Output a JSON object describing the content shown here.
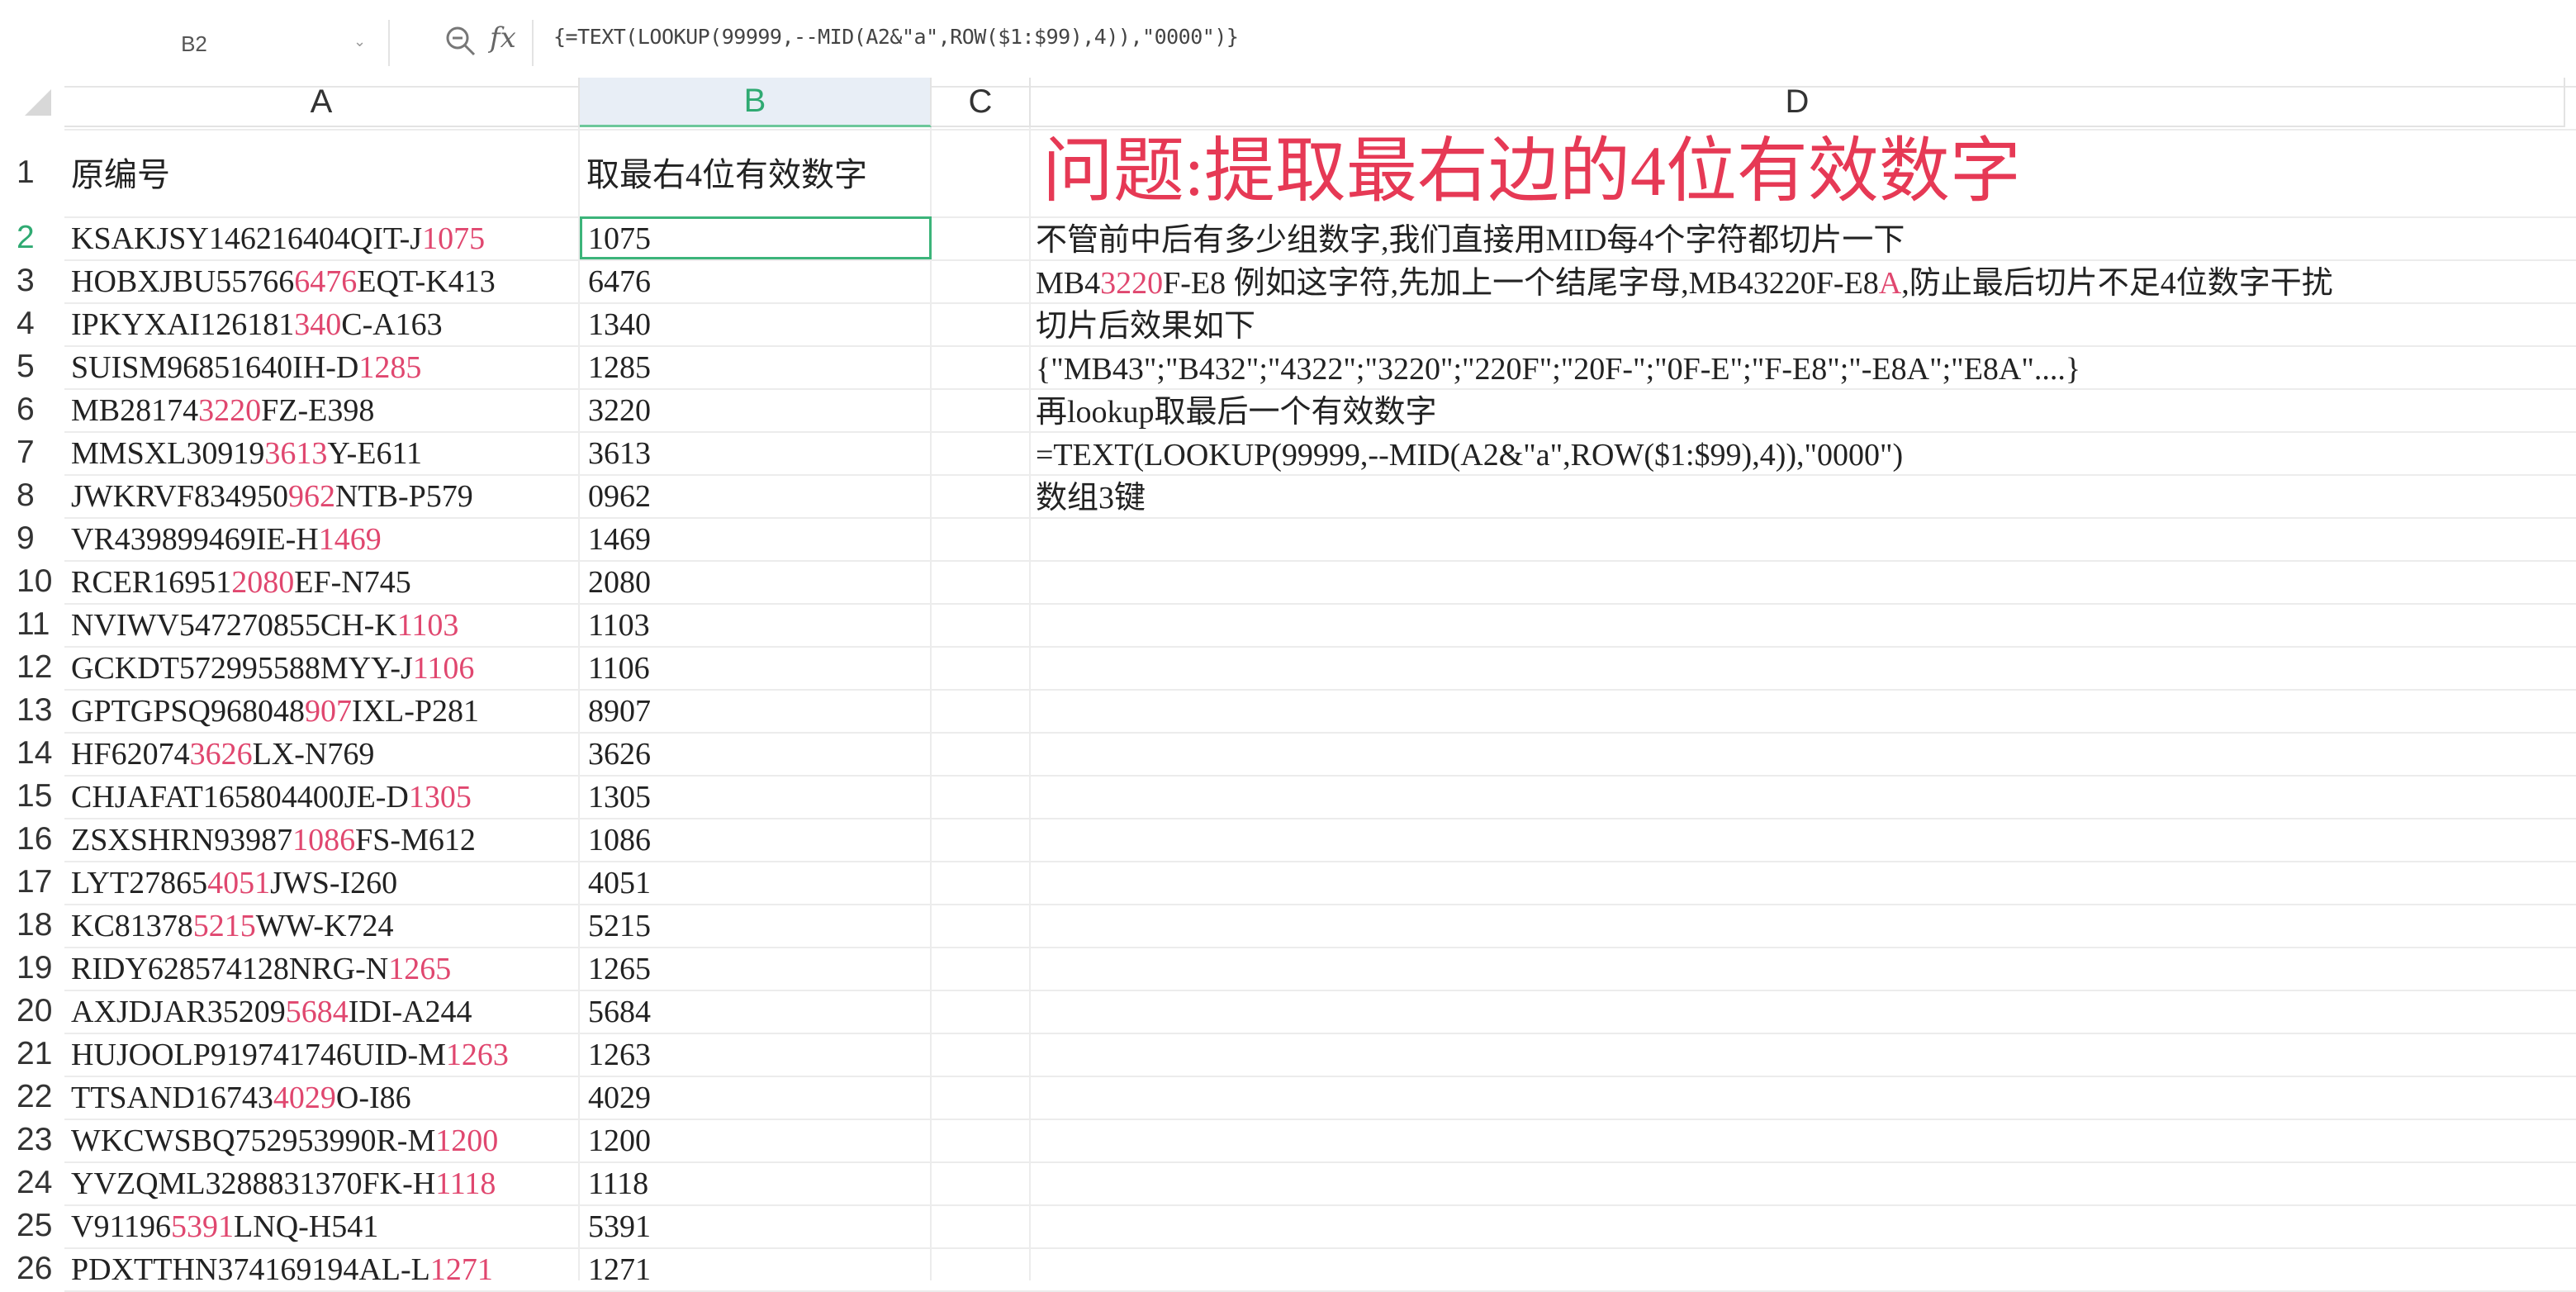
{
  "formula_bar": {
    "name_box": "B2",
    "fx_label": "fx",
    "formula": "{=TEXT(LOOKUP(99999,--MID(A2&\"a\",ROW($1:$99),4)),\"0000\")}"
  },
  "columns": [
    "A",
    "B",
    "C",
    "D"
  ],
  "selected_cell": "B2",
  "header_row": {
    "row_number": "1",
    "a": "原编号",
    "b": "取最右4位有效数字"
  },
  "rows": [
    {
      "n": "2",
      "a_pre": "KSAKJSY146216404QIT-J",
      "a_hl": "1075",
      "a_post": "",
      "b": "1075"
    },
    {
      "n": "3",
      "a_pre": "HOBXJBU55766",
      "a_hl": "6476",
      "a_post": "EQT-K413",
      "b": "6476"
    },
    {
      "n": "4",
      "a_pre": "IPKYXAI126181",
      "a_hl": "340",
      "a_post": "C-A163",
      "b": "1340"
    },
    {
      "n": "5",
      "a_pre": "SUISM96851640IH-D",
      "a_hl": "1285",
      "a_post": "",
      "b": "1285"
    },
    {
      "n": "6",
      "a_pre": "MB28174",
      "a_hl": "3220",
      "a_post": "FZ-E398",
      "b": "3220"
    },
    {
      "n": "7",
      "a_pre": "MMSXL30919",
      "a_hl": "3613",
      "a_post": "Y-E611",
      "b": "3613"
    },
    {
      "n": "8",
      "a_pre": "JWKRVF834950",
      "a_hl": "962",
      "a_post": "NTB-P579",
      "b": "0962"
    },
    {
      "n": "9",
      "a_pre": "VR439899469IE-H",
      "a_hl": "1469",
      "a_post": "",
      "b": "1469"
    },
    {
      "n": "10",
      "a_pre": "RCER16951",
      "a_hl": "2080",
      "a_post": "EF-N745",
      "b": "2080"
    },
    {
      "n": "11",
      "a_pre": "NVIWV547270855CH-K",
      "a_hl": "1103",
      "a_post": "",
      "b": "1103"
    },
    {
      "n": "12",
      "a_pre": "GCKDT572995588MYY-J",
      "a_hl": "1106",
      "a_post": "",
      "b": "1106"
    },
    {
      "n": "13",
      "a_pre": "GPTGPSQ968048",
      "a_hl": "907",
      "a_post": "IXL-P281",
      "b": "8907"
    },
    {
      "n": "14",
      "a_pre": "HF62074",
      "a_hl": "3626",
      "a_post": "LX-N769",
      "b": "3626"
    },
    {
      "n": "15",
      "a_pre": "CHJAFAT165804400JE-D",
      "a_hl": "1305",
      "a_post": "",
      "b": "1305"
    },
    {
      "n": "16",
      "a_pre": "ZSXSHRN93987",
      "a_hl": "1086",
      "a_post": "FS-M612",
      "b": "1086"
    },
    {
      "n": "17",
      "a_pre": "LYT27865",
      "a_hl": "4051",
      "a_post": "JWS-I260",
      "b": "4051"
    },
    {
      "n": "18",
      "a_pre": "KC81378",
      "a_hl": "5215",
      "a_post": "WW-K724",
      "b": "5215"
    },
    {
      "n": "19",
      "a_pre": "RIDY628574128NRG-N",
      "a_hl": "1265",
      "a_post": "",
      "b": "1265"
    },
    {
      "n": "20",
      "a_pre": "AXJDJAR35209",
      "a_hl": "5684",
      "a_post": "IDI-A244",
      "b": "5684"
    },
    {
      "n": "21",
      "a_pre": "HUJOOLP919741746UID-M",
      "a_hl": "1263",
      "a_post": "",
      "b": "1263"
    },
    {
      "n": "22",
      "a_pre": "TTSAND16743",
      "a_hl": "4029",
      "a_post": "O-I86",
      "b": "4029"
    },
    {
      "n": "23",
      "a_pre": "WKCWSBQ752953990R-M",
      "a_hl": "1200",
      "a_post": "",
      "b": "1200"
    },
    {
      "n": "24",
      "a_pre": "YVZQML3288831370FK-H",
      "a_hl": "1118",
      "a_post": "",
      "b": "1118"
    },
    {
      "n": "25",
      "a_pre": "V91196",
      "a_hl": "5391",
      "a_post": "LNQ-H541",
      "b": "5391"
    },
    {
      "n": "26",
      "a_pre": "PDXTTHN374169194AL-L",
      "a_hl": "1271",
      "a_post": "",
      "b": "1271"
    }
  ],
  "notes": {
    "title": "问题:提取最右边的4位有效数字",
    "line1": "不管前中后有多少组数字,我们直接用MID每4个字符都切片一下",
    "line2_pre": "MB4",
    "line2_hl": "3220",
    "line2_mid": "F-E8 例如这字符,先加上一个结尾字母,MB43220F-E8",
    "line2_hl2": "A",
    "line2_post": ",防止最后切片不足4位数字干扰",
    "line3": "切片后效果如下",
    "line4": "{\"MB43\";\"B432\";\"4322\";\"3220\";\"220F\";\"20F-\";\"0F-E\";\"F-E8\";\"-E8A\";\"E8A\"....}",
    "line5": "再lookup取最后一个有效数字",
    "line6": "=TEXT(LOOKUP(99999,--MID(A2&\"a\",ROW($1:$99),4)),\"0000\")",
    "line7": "数组3键"
  }
}
